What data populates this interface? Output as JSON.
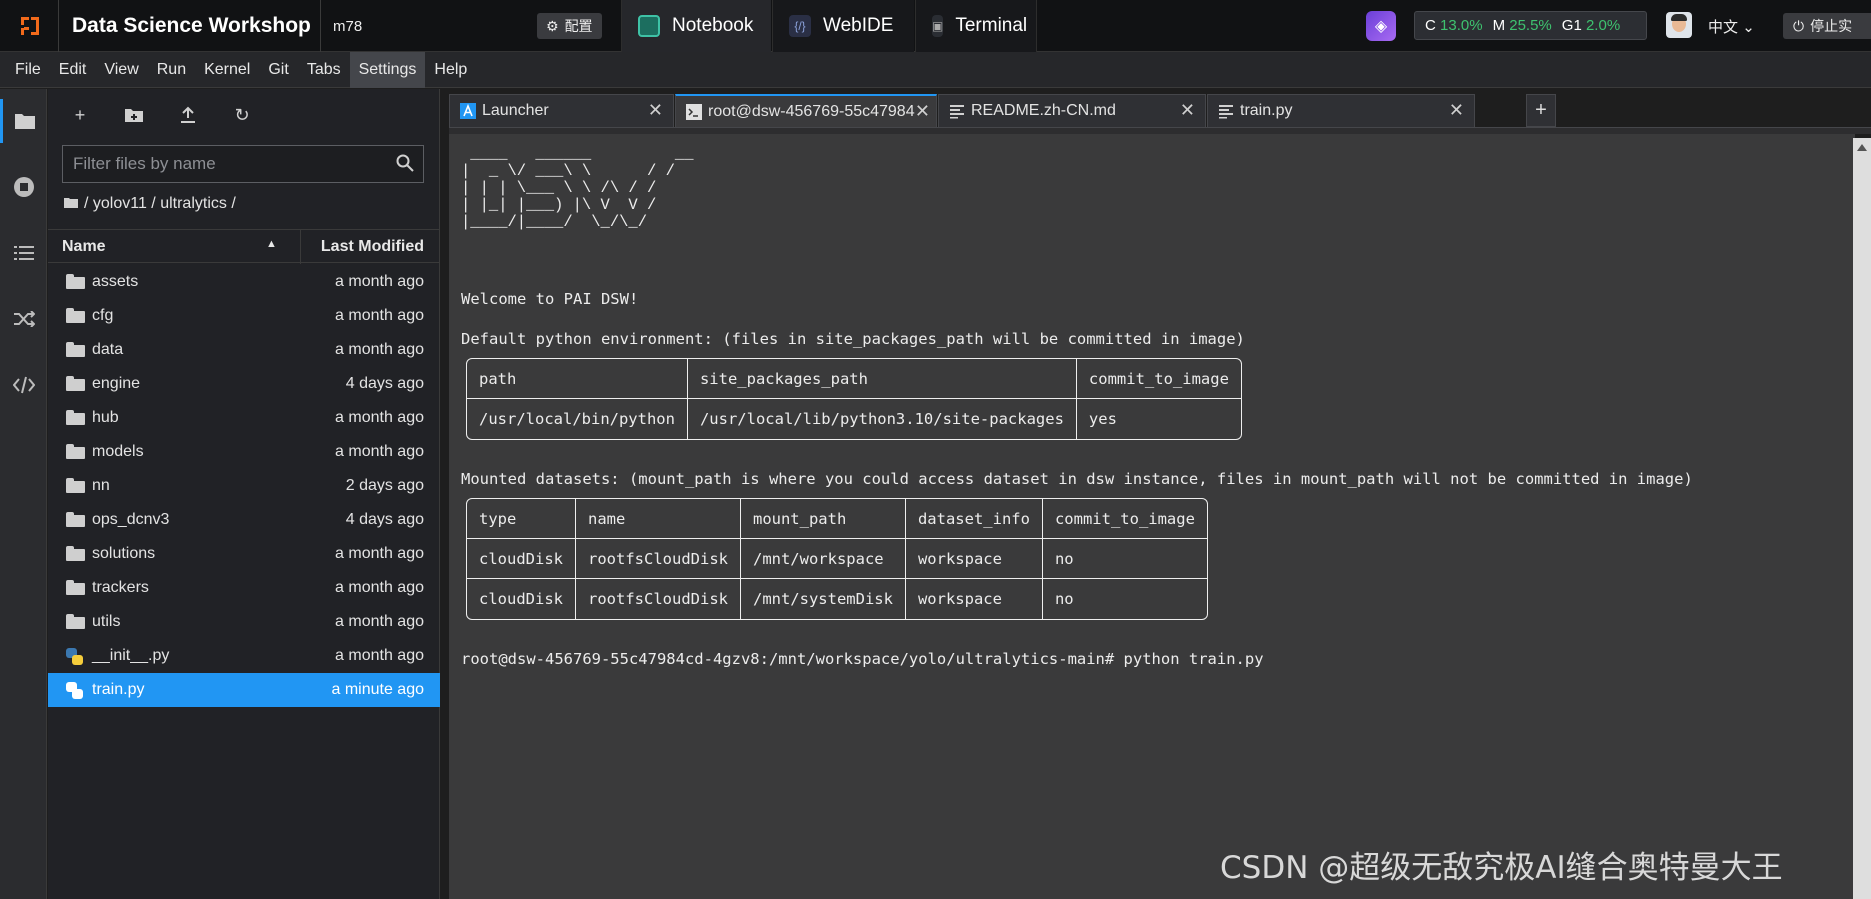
{
  "topbar": {
    "app_title": "Data Science Workshop",
    "instance": "m78",
    "config_label": "配置",
    "tabs": [
      {
        "label": "Notebook"
      },
      {
        "label": "WebIDE"
      },
      {
        "label": "Terminal"
      }
    ],
    "resources": {
      "c_key": "C",
      "c_val": "13.0%",
      "m_key": "M",
      "m_val": "25.5%",
      "g_key": "G1",
      "g_val": "2.0%"
    },
    "language": "中文",
    "stop_label": "停止实"
  },
  "menubar": {
    "items": [
      "File",
      "Edit",
      "View",
      "Run",
      "Kernel",
      "Git",
      "Tabs",
      "Settings",
      "Help"
    ],
    "active": "Settings"
  },
  "filebrowser": {
    "filter_placeholder": "Filter files by name",
    "breadcrumb": "/ yolov11 / ultralytics /",
    "col_name": "Name",
    "col_modified": "Last Modified",
    "files": [
      {
        "name": "assets",
        "modified": "a month ago",
        "type": "folder"
      },
      {
        "name": "cfg",
        "modified": "a month ago",
        "type": "folder"
      },
      {
        "name": "data",
        "modified": "a month ago",
        "type": "folder"
      },
      {
        "name": "engine",
        "modified": "4 days ago",
        "type": "folder"
      },
      {
        "name": "hub",
        "modified": "a month ago",
        "type": "folder"
      },
      {
        "name": "models",
        "modified": "a month ago",
        "type": "folder"
      },
      {
        "name": "nn",
        "modified": "2 days ago",
        "type": "folder"
      },
      {
        "name": "ops_dcnv3",
        "modified": "4 days ago",
        "type": "folder"
      },
      {
        "name": "solutions",
        "modified": "a month ago",
        "type": "folder"
      },
      {
        "name": "trackers",
        "modified": "a month ago",
        "type": "folder"
      },
      {
        "name": "utils",
        "modified": "a month ago",
        "type": "folder"
      },
      {
        "name": "__init__.py",
        "modified": "a month ago",
        "type": "python"
      },
      {
        "name": "train.py",
        "modified": "a minute ago",
        "type": "python",
        "selected": true
      }
    ]
  },
  "editor_tabs": [
    {
      "label": "Launcher"
    },
    {
      "label": "root@dsw-456769-55c47984"
    },
    {
      "label": "README.zh-CN.md"
    },
    {
      "label": "train.py"
    }
  ],
  "terminal": {
    "ascii_art": " ____   ______         __\n|  _ \\/ ___\\ \\      / /\n| | | \\___ \\ \\ /\\ / /\n| |_| |___) |\\ V  V /\n|____/|____/  \\_/\\_/",
    "welcome": "Welcome to PAI DSW!",
    "default_env": "Default python environment: (files in site_packages_path will be committed in image)",
    "env_table": {
      "headers": [
        "path",
        "site_packages_path",
        "commit_to_image"
      ],
      "rows": [
        [
          "/usr/local/bin/python",
          "/usr/local/lib/python3.10/site-packages",
          "yes"
        ]
      ]
    },
    "mounted": "Mounted datasets: (mount_path is where you could access dataset in dsw instance, files in mount_path will not be committed in image)",
    "ds_table": {
      "headers": [
        "type",
        "name",
        "mount_path",
        "dataset_info",
        "commit_to_image"
      ],
      "rows": [
        [
          "cloudDisk",
          "rootfsCloudDisk",
          "/mnt/workspace",
          "workspace",
          "no"
        ],
        [
          "cloudDisk",
          "rootfsCloudDisk",
          "/mnt/systemDisk",
          "workspace",
          "no"
        ]
      ]
    },
    "prompt": "root@dsw-456769-55c47984cd-4gzv8:/mnt/workspace/yolo/ultralytics-main# python train.py"
  },
  "watermark": "CSDN @超级无敌究极AI缝合奥特曼大王",
  "colors": {
    "accent": "#2196f3",
    "resource_value": "#3ec26f",
    "logo": "#f26a1b"
  }
}
